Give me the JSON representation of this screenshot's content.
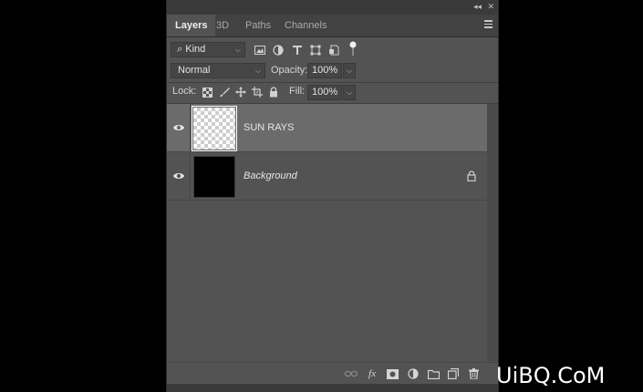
{
  "panel": {
    "collapse_glyph": "◂◂",
    "close_glyph": "✕",
    "tabs": [
      {
        "label": "Layers",
        "active": true
      },
      {
        "label": "3D",
        "active": false
      },
      {
        "label": "Paths",
        "active": false
      },
      {
        "label": "Channels",
        "active": false
      }
    ],
    "menu_icon": "hamburger-icon"
  },
  "filter": {
    "kind_label": "Kind",
    "search_glyph": "⌕",
    "icons": [
      "image-filter-icon",
      "adjustment-filter-icon",
      "type-filter-icon",
      "shape-filter-icon",
      "smart-object-filter-icon",
      "filter-toggle-icon"
    ]
  },
  "blend": {
    "mode": "Normal",
    "opacity_label": "Opacity:",
    "opacity_value": "100%"
  },
  "lock": {
    "label": "Lock:",
    "icons": [
      "lock-transparent-icon",
      "lock-image-icon",
      "lock-position-icon",
      "lock-artboard-icon",
      "lock-all-icon"
    ],
    "fill_label": "Fill:",
    "fill_value": "100%"
  },
  "layers": [
    {
      "name": "SUN RAYS",
      "visible": true,
      "selected": true,
      "thumbnail": "transparent",
      "locked": false
    },
    {
      "name": "Background",
      "visible": true,
      "selected": false,
      "thumbnail": "black",
      "locked": true
    }
  ],
  "bottom_icons": [
    "link-layers-icon",
    "fx-icon",
    "add-mask-icon",
    "adjustment-layer-icon",
    "new-group-icon",
    "new-layer-icon",
    "delete-icon"
  ],
  "bottom_fx_text": "fx",
  "watermark": "UiBQ.CoM",
  "colors": {
    "panel_bg": "#535353",
    "selected_row": "#6b6b6b",
    "background_black": "#000000"
  }
}
